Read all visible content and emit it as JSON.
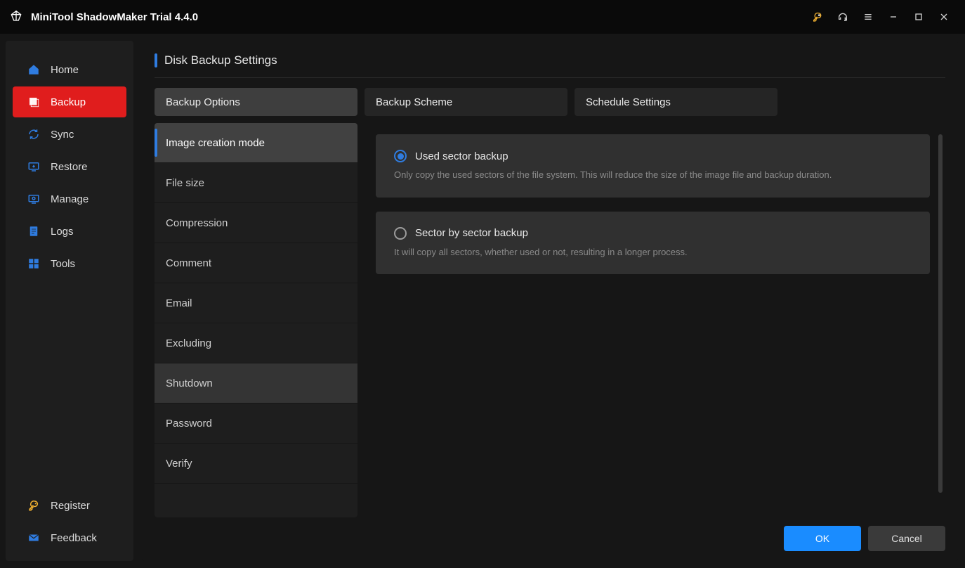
{
  "app": {
    "title": "MiniTool ShadowMaker Trial 4.4.0"
  },
  "titlebar": {
    "icons": [
      "key",
      "headset",
      "menu",
      "minimize",
      "maximize",
      "close"
    ]
  },
  "sidebar": {
    "top": [
      {
        "label": "Home",
        "icon": "home",
        "active": false
      },
      {
        "label": "Backup",
        "icon": "backup",
        "active": true
      },
      {
        "label": "Sync",
        "icon": "sync",
        "active": false
      },
      {
        "label": "Restore",
        "icon": "restore",
        "active": false
      },
      {
        "label": "Manage",
        "icon": "manage",
        "active": false
      },
      {
        "label": "Logs",
        "icon": "logs",
        "active": false
      },
      {
        "label": "Tools",
        "icon": "tools",
        "active": false
      }
    ],
    "bottom": [
      {
        "label": "Register",
        "icon": "key"
      },
      {
        "label": "Feedback",
        "icon": "mail"
      }
    ]
  },
  "page": {
    "title": "Disk Backup Settings"
  },
  "tabs": [
    {
      "label": "Backup Options",
      "active": true
    },
    {
      "label": "Backup Scheme",
      "active": false
    },
    {
      "label": "Schedule Settings",
      "active": false
    }
  ],
  "options_sidebar": [
    {
      "label": "Image creation mode",
      "selected": true
    },
    {
      "label": "File size"
    },
    {
      "label": "Compression"
    },
    {
      "label": "Comment"
    },
    {
      "label": "Email"
    },
    {
      "label": "Excluding"
    },
    {
      "label": "Shutdown",
      "highlight": true
    },
    {
      "label": "Password"
    },
    {
      "label": "Verify"
    }
  ],
  "image_creation_mode": {
    "options": [
      {
        "title": "Used sector backup",
        "desc": "Only copy the used sectors of the file system. This will reduce the size of the image file and backup duration.",
        "selected": true
      },
      {
        "title": "Sector by sector backup",
        "desc": "It will copy all sectors, whether used or not, resulting in a longer process.",
        "selected": false
      }
    ]
  },
  "footer": {
    "ok": "OK",
    "cancel": "Cancel"
  },
  "colors": {
    "accent": "#2f7ce0",
    "danger": "#e01d1d",
    "primary_btn": "#1a8cff"
  }
}
